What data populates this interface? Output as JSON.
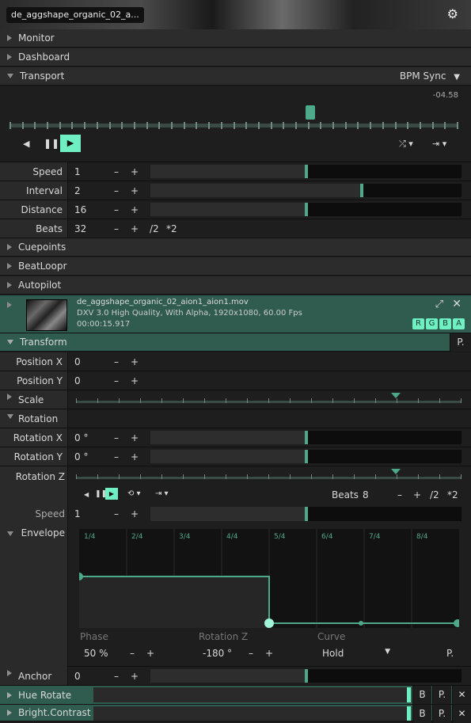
{
  "window": {
    "title": "de_aggshape_organic_02_a..."
  },
  "sections": {
    "monitor": "Monitor",
    "dashboard": "Dashboard",
    "transport": "Transport",
    "bpm_sync": "BPM Sync",
    "cuepoints": "Cuepoints",
    "beatloopr": "BeatLoopr",
    "autopilot": "Autopilot",
    "transform": "Transform",
    "scale": "Scale",
    "rotation": "Rotation",
    "rotation_z": "Rotation Z",
    "envelope": "Envelope",
    "anchor": "Anchor",
    "hue_rotate": "Hue Rotate",
    "bright_contrast": "Bright.Contrast"
  },
  "transport": {
    "time": "-04.58",
    "position": 0.67
  },
  "params": {
    "speed": {
      "label": "Speed",
      "value": "1",
      "level": 0.5
    },
    "interval": {
      "label": "Interval",
      "value": "2",
      "level": 0.68
    },
    "distance": {
      "label": "Distance",
      "value": "16",
      "level": 0.5
    },
    "beats": {
      "label": "Beats",
      "value": "32",
      "half": "/2",
      "double": "*2"
    }
  },
  "symbols": {
    "minus": "–",
    "plus": "+"
  },
  "clip": {
    "filename": "de_aggshape_organic_02_aion1_aion1.mov",
    "codec": "DXV 3.0 High Quality, With Alpha, 1920x1080, 60.00 Fps",
    "duration": "00:00:15.917",
    "channels": [
      "R",
      "G",
      "B",
      "A"
    ]
  },
  "transform": {
    "p_btn": "P.",
    "position_x": {
      "label": "Position X",
      "value": "0"
    },
    "position_y": {
      "label": "Position Y",
      "value": "0"
    },
    "scale_marker": 0.83,
    "rotation_x": {
      "label": "Rotation X",
      "value": "0 °",
      "level": 0.5
    },
    "rotation_y": {
      "label": "Rotation Y",
      "value": "0 °",
      "level": 0.5
    },
    "rotation_z_marker": 0.83,
    "rz_beats": {
      "label": "Beats",
      "value": "8",
      "half": "/2",
      "double": "*2"
    },
    "rz_speed": {
      "label": "Speed",
      "value": "1",
      "level": 0.5
    },
    "envelope": {
      "markers": [
        "1/4",
        "2/4",
        "3/4",
        "4/4",
        "5/4",
        "6/4",
        "7/4",
        "8/4"
      ],
      "phase_label": "Phase",
      "phase_value": "50 %",
      "rot_label": "Rotation Z",
      "rot_value": "-180 °",
      "curve_label": "Curve",
      "curve_value": "Hold",
      "p_btn": "P."
    },
    "anchor": {
      "label": "Anchor",
      "value": "0",
      "level": 0.5
    }
  },
  "effects": {
    "b": "B",
    "p": "P.",
    "x": "✕"
  },
  "colors": {
    "accent": "#6ef0c2",
    "panel_teal": "#2f5c4f"
  }
}
